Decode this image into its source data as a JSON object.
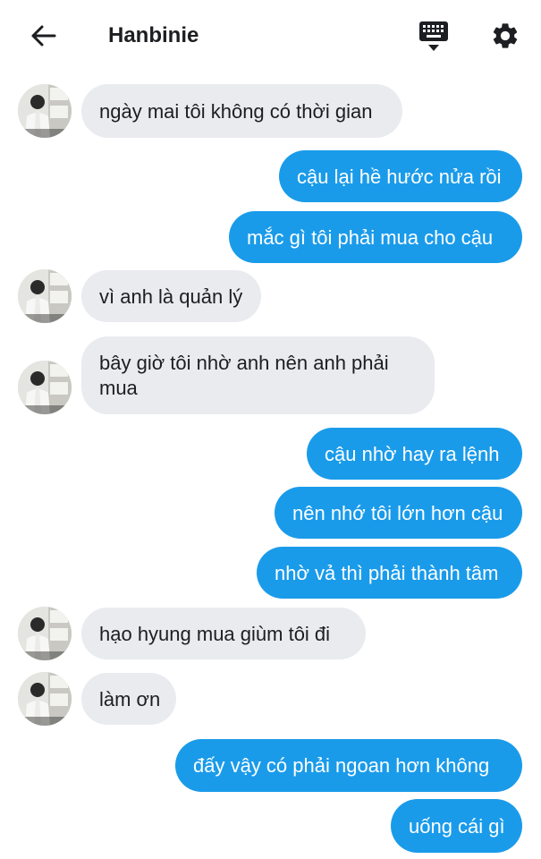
{
  "header": {
    "title": "Hanbinie",
    "back_icon": "arrow-left-icon",
    "keyboard_icon": "keyboard-icon",
    "settings_icon": "gear-icon"
  },
  "colors": {
    "outgoing_bubble": "#1a9bea",
    "incoming_bubble": "#e9ebef"
  },
  "messages": [
    {
      "from": "them",
      "text": "ngày mai tôi không có thời gian"
    },
    {
      "from": "me",
      "text": "cậu lại hề hước nửa rồi"
    },
    {
      "from": "me",
      "text": "mắc gì tôi phải mua cho cậu"
    },
    {
      "from": "them",
      "text": "vì anh là quản lý"
    },
    {
      "from": "them",
      "text": "bây giờ tôi nhờ anh nên anh phải mua"
    },
    {
      "from": "me",
      "text": "cậu nhờ hay ra lệnh"
    },
    {
      "from": "me",
      "text": "nên nhớ tôi lớn hơn cậu"
    },
    {
      "from": "me",
      "text": "nhờ vả thì phải thành tâm"
    },
    {
      "from": "them",
      "text": "hạo hyung mua giùm tôi đi"
    },
    {
      "from": "them",
      "text": "làm ơn"
    },
    {
      "from": "me",
      "text": "đấy vậy có phải ngoan hơn không"
    },
    {
      "from": "me",
      "text": "uống cái gì"
    }
  ]
}
